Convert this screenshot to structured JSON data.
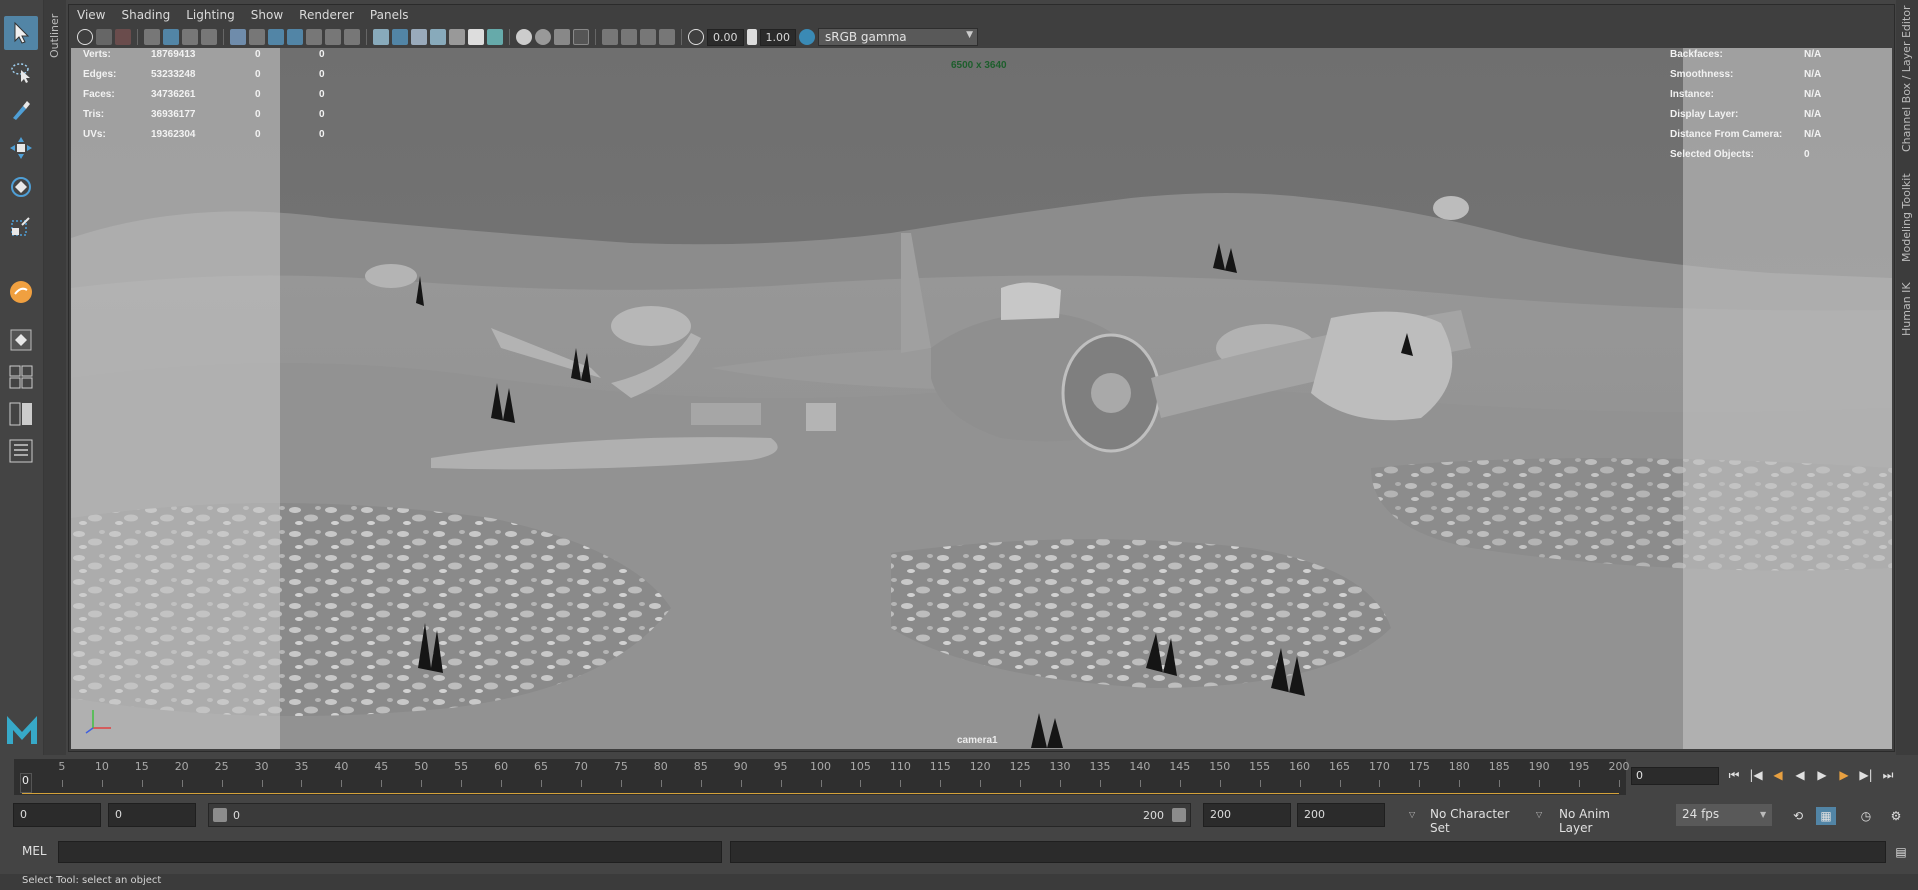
{
  "app": {
    "name": "Maya"
  },
  "outliner_tab": {
    "label": "Outliner"
  },
  "right_tabs": [
    {
      "label": "Channel Box / Layer Editor"
    },
    {
      "label": "Modeling Toolkit"
    },
    {
      "label": "Human IK"
    }
  ],
  "panel_menu": [
    {
      "label": "View"
    },
    {
      "label": "Shading"
    },
    {
      "label": "Lighting"
    },
    {
      "label": "Show"
    },
    {
      "label": "Renderer"
    },
    {
      "label": "Panels"
    }
  ],
  "panel_toolbar": {
    "exposure_value": "0.00",
    "gamma_value": "1.00",
    "color_space": "sRGB gamma"
  },
  "hud": {
    "stats": [
      {
        "label": "Verts:",
        "v1": "18769413",
        "v2": "0",
        "v3": "0"
      },
      {
        "label": "Edges:",
        "v1": "53233248",
        "v2": "0",
        "v3": "0"
      },
      {
        "label": "Faces:",
        "v1": "34736261",
        "v2": "0",
        "v3": "0"
      },
      {
        "label": "Tris:",
        "v1": "36936177",
        "v2": "0",
        "v3": "0"
      },
      {
        "label": "UVs:",
        "v1": "19362304",
        "v2": "0",
        "v3": "0"
      }
    ],
    "resolution": "6500 x 3640",
    "object_details": [
      {
        "label": "Backfaces:",
        "value": "N/A"
      },
      {
        "label": "Smoothness:",
        "value": "N/A"
      },
      {
        "label": "Instance:",
        "value": "N/A"
      },
      {
        "label": "Display Layer:",
        "value": "N/A"
      },
      {
        "label": "Distance From Camera:",
        "value": "N/A"
      },
      {
        "label": "Selected Objects:",
        "value": "0"
      }
    ],
    "camera": "camera1"
  },
  "time_slider": {
    "tick_labels": [
      "0",
      "5",
      "10",
      "15",
      "20",
      "25",
      "30",
      "35",
      "40",
      "45",
      "50",
      "55",
      "60",
      "65",
      "70",
      "75",
      "80",
      "85",
      "90",
      "95",
      "100",
      "105",
      "110",
      "115",
      "120",
      "125",
      "130",
      "135",
      "140",
      "145",
      "150",
      "155",
      "160",
      "165",
      "170",
      "175",
      "180",
      "185",
      "190",
      "195",
      "200"
    ],
    "current_frame": "0",
    "current_frame_field": "0"
  },
  "range_slider": {
    "animation_start": "0",
    "playback_start": "0",
    "slider_start": "0",
    "slider_end": "200",
    "playback_end": "200",
    "animation_end": "200",
    "character_set": "No Character Set",
    "anim_layer": "No Anim Layer",
    "fps": "24 fps"
  },
  "command_line": {
    "label": "MEL"
  },
  "help_line": {
    "text": "Select Tool: select an object"
  }
}
